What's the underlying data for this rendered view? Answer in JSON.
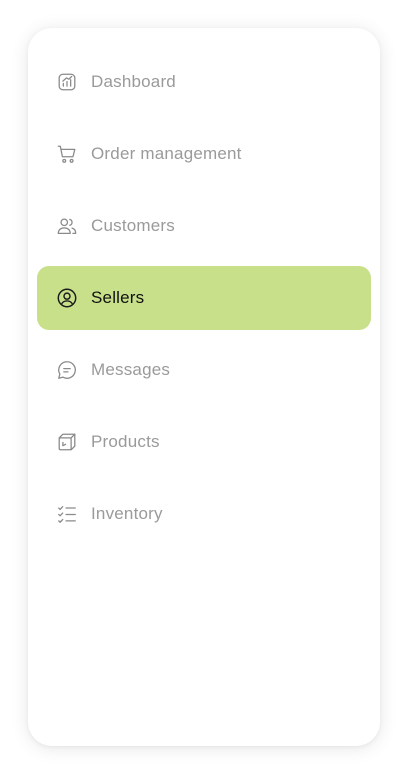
{
  "sidebar": {
    "accent_color": "#c9e08b",
    "items": [
      {
        "label": "Dashboard",
        "icon": "chart-icon",
        "active": false
      },
      {
        "label": "Order management",
        "icon": "cart-icon",
        "active": false
      },
      {
        "label": "Customers",
        "icon": "users-icon",
        "active": false
      },
      {
        "label": "Sellers",
        "icon": "user-circle-icon",
        "active": true
      },
      {
        "label": "Messages",
        "icon": "message-icon",
        "active": false
      },
      {
        "label": "Products",
        "icon": "box-icon",
        "active": false
      },
      {
        "label": "Inventory",
        "icon": "checklist-icon",
        "active": false
      }
    ]
  }
}
